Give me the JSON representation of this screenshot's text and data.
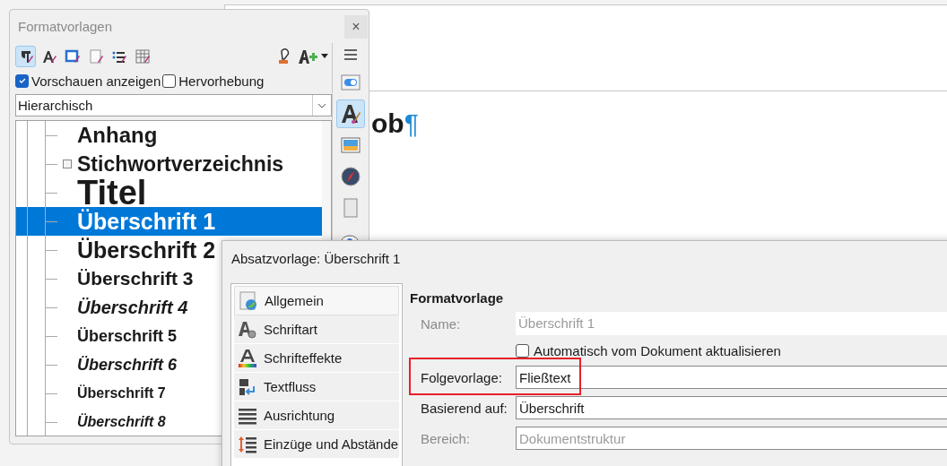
{
  "document": {
    "text": "ob",
    "mark": "¶"
  },
  "panel": {
    "title": "Formatvorlagen",
    "close": "×",
    "toolbar": [
      {
        "selected": true
      },
      {
        "selected": false
      },
      {
        "selected": false
      },
      {
        "selected": false
      },
      {
        "selected": false
      },
      {
        "selected": false
      }
    ],
    "show_previews": {
      "label": "Vorschauen anzeigen",
      "checked": true
    },
    "highlighting": {
      "label": "Hervorhebung",
      "checked": false
    },
    "filter": {
      "value": "Hierarchisch"
    },
    "styles": [
      {
        "name": "Anhang",
        "italic": false,
        "has_children": false,
        "selected": false
      },
      {
        "name": "Stichwortverzeichnis",
        "italic": false,
        "has_children": true,
        "selected": false
      },
      {
        "name": "Titel",
        "italic": false,
        "has_children": false,
        "selected": false
      },
      {
        "name": "Überschrift 1",
        "italic": false,
        "has_children": false,
        "selected": true
      },
      {
        "name": "Überschrift 2",
        "italic": false,
        "has_children": false,
        "selected": false
      },
      {
        "name": "Überschrift 3",
        "italic": false,
        "has_children": false,
        "selected": false
      },
      {
        "name": "Überschrift 4",
        "italic": true,
        "has_children": false,
        "selected": false
      },
      {
        "name": "Überschrift 5",
        "italic": false,
        "has_children": false,
        "selected": false
      },
      {
        "name": "Überschrift 6",
        "italic": true,
        "has_children": false,
        "selected": false
      },
      {
        "name": "Überschrift 7",
        "italic": false,
        "has_children": false,
        "selected": false
      },
      {
        "name": "Überschrift 8",
        "italic": true,
        "has_children": false,
        "selected": false
      }
    ]
  },
  "sidebar": {
    "items": [
      {
        "selected": false
      },
      {
        "selected": true
      },
      {
        "selected": false
      },
      {
        "selected": false
      },
      {
        "selected": false
      },
      {
        "selected": false
      }
    ]
  },
  "dialog": {
    "title": "Absatzvorlage: Überschrift 1",
    "nav": [
      {
        "label": "Allgemein",
        "selected": true
      },
      {
        "label": "Schriftart",
        "selected": false
      },
      {
        "label": "Schrifteffekte",
        "selected": false
      },
      {
        "label": "Textfluss",
        "selected": false
      },
      {
        "label": "Ausrichtung",
        "selected": false
      },
      {
        "label": "Einzüge und Abstände",
        "selected": false
      }
    ],
    "section": "Formatvorlage",
    "rows": [
      {
        "kind": "field",
        "label": "Name:",
        "value": "Überschrift 1",
        "disabled": true,
        "highlighted": false
      },
      {
        "kind": "checkbox",
        "label": "Automatisch vom Dokument aktualisieren",
        "checked": false
      },
      {
        "kind": "field",
        "label": "Folgevorlage:",
        "value": "Fließtext",
        "disabled": false,
        "highlighted": true
      },
      {
        "kind": "field",
        "label": "Basierend auf:",
        "value": "Überschrift",
        "disabled": false,
        "highlighted": false
      },
      {
        "kind": "field",
        "label": "Bereich:",
        "value": "Dokumentstruktur",
        "disabled": true,
        "highlighted": false
      }
    ]
  }
}
